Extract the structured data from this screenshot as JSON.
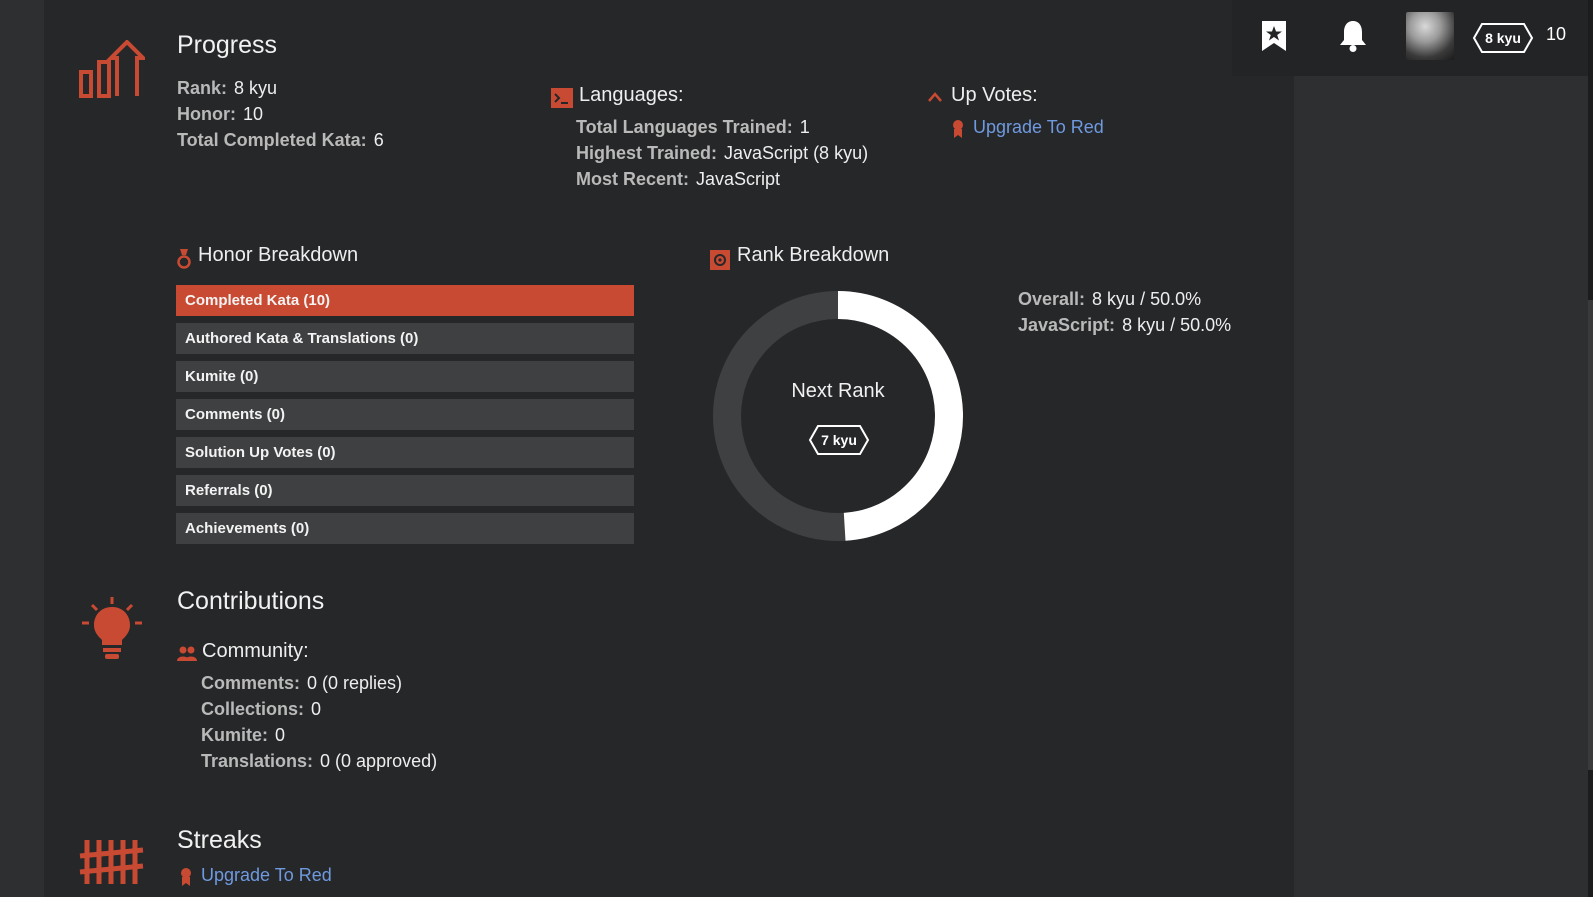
{
  "topbar": {
    "bookmark_icon": "bookmark-star-icon",
    "bell_icon": "bell-icon",
    "rank_badge": "8 kyu",
    "honor": "10"
  },
  "progress": {
    "title": "Progress",
    "icon": "progress-chart-icon",
    "rank_label": "Rank:",
    "rank_value": "8 kyu",
    "honor_label": "Honor:",
    "honor_value": "10",
    "completed_label": "Total Completed Kata:",
    "completed_value": "6",
    "languages": {
      "title": "Languages:",
      "total_label": "Total Languages Trained:",
      "total_value": "1",
      "highest_label": "Highest Trained:",
      "highest_value": "JavaScript (8 kyu)",
      "recent_label": "Most Recent:",
      "recent_value": "JavaScript"
    },
    "upvotes": {
      "title": "Up Votes:",
      "link": "Upgrade To Red"
    }
  },
  "honor_breakdown": {
    "title": "Honor Breakdown",
    "items": [
      {
        "label": "Completed Kata (10)",
        "active": true
      },
      {
        "label": "Authored Kata & Translations (0)",
        "active": false
      },
      {
        "label": "Kumite (0)",
        "active": false
      },
      {
        "label": "Comments (0)",
        "active": false
      },
      {
        "label": "Solution Up Votes (0)",
        "active": false
      },
      {
        "label": "Referrals (0)",
        "active": false
      },
      {
        "label": "Achievements (0)",
        "active": false
      }
    ]
  },
  "rank_breakdown": {
    "title": "Rank Breakdown",
    "next_rank_label": "Next Rank",
    "next_rank_badge": "7 kyu",
    "progress_fraction": 0.5,
    "overall_label": "Overall:",
    "overall_value": "8 kyu / 50.0%",
    "js_label": "JavaScript:",
    "js_value": "8 kyu / 50.0%",
    "colors": {
      "progress": "#ffffff",
      "remaining": "#3f4042"
    }
  },
  "contributions": {
    "title": "Contributions",
    "icon": "lightbulb-icon",
    "community_title": "Community:",
    "comments_label": "Comments:",
    "comments_value": "0 (0 replies)",
    "collections_label": "Collections:",
    "collections_value": "0",
    "kumite_label": "Kumite:",
    "kumite_value": "0",
    "translations_label": "Translations:",
    "translations_value": "0 (0 approved)"
  },
  "streaks": {
    "title": "Streaks",
    "icon": "tally-marks-icon",
    "link": "Upgrade To Red"
  },
  "colors": {
    "accent": "#c94a32",
    "link": "#6f9ae0",
    "background": "#262729"
  }
}
